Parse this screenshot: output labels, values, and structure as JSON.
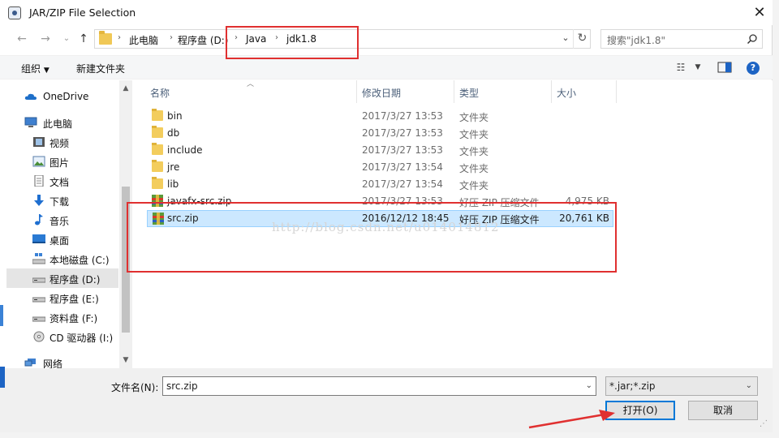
{
  "window": {
    "title": "JAR/ZIP File Selection"
  },
  "address": {
    "crumbs": [
      "此电脑",
      "程序盘 (D:)",
      "Java",
      "jdk1.8"
    ]
  },
  "search": {
    "placeholder": "搜索\"jdk1.8\""
  },
  "toolbar": {
    "organize": "组织",
    "new_folder": "新建文件夹"
  },
  "sidebar": {
    "items": [
      {
        "label": "OneDrive",
        "icon": "cloud-icon"
      },
      {
        "label": "此电脑",
        "icon": "computer-icon"
      },
      {
        "label": "视频",
        "icon": "video-icon"
      },
      {
        "label": "图片",
        "icon": "pictures-icon"
      },
      {
        "label": "文档",
        "icon": "documents-icon"
      },
      {
        "label": "下载",
        "icon": "download-icon"
      },
      {
        "label": "音乐",
        "icon": "music-icon"
      },
      {
        "label": "桌面",
        "icon": "desktop-icon"
      },
      {
        "label": "本地磁盘 (C:)",
        "icon": "drive-c-icon"
      },
      {
        "label": "程序盘 (D:)",
        "icon": "drive-icon"
      },
      {
        "label": "程序盘 (E:)",
        "icon": "drive-icon"
      },
      {
        "label": "资料盘 (F:)",
        "icon": "drive-icon"
      },
      {
        "label": "CD 驱动器 (I:)",
        "icon": "cd-drive-icon"
      },
      {
        "label": "网络",
        "icon": "network-icon"
      }
    ]
  },
  "columns": {
    "name": "名称",
    "modified": "修改日期",
    "type": "类型",
    "size": "大小"
  },
  "files": [
    {
      "name": "bin",
      "modified": "2017/3/27 13:53",
      "type": "文件夹",
      "size": ""
    },
    {
      "name": "db",
      "modified": "2017/3/27 13:53",
      "type": "文件夹",
      "size": ""
    },
    {
      "name": "include",
      "modified": "2017/3/27 13:53",
      "type": "文件夹",
      "size": ""
    },
    {
      "name": "jre",
      "modified": "2017/3/27 13:54",
      "type": "文件夹",
      "size": ""
    },
    {
      "name": "lib",
      "modified": "2017/3/27 13:54",
      "type": "文件夹",
      "size": ""
    },
    {
      "name": "javafx-src.zip",
      "modified": "2017/3/27 13:53",
      "type": "好压 ZIP 压缩文件",
      "size": "4,975 KB"
    },
    {
      "name": "src.zip",
      "modified": "2016/12/12 18:45",
      "type": "好压 ZIP 压缩文件",
      "size": "20,761 KB"
    }
  ],
  "watermark": "http://blog.csdn.net/u014014812",
  "footer": {
    "filename_label": "文件名(N):",
    "filename_value": "src.zip",
    "filetype_value": "*.jar;*.zip",
    "open_label": "打开(O)",
    "cancel_label": "取消"
  },
  "colors": {
    "annotation": "#e03030",
    "selection": "#cce8ff",
    "accent": "#0078d7"
  }
}
